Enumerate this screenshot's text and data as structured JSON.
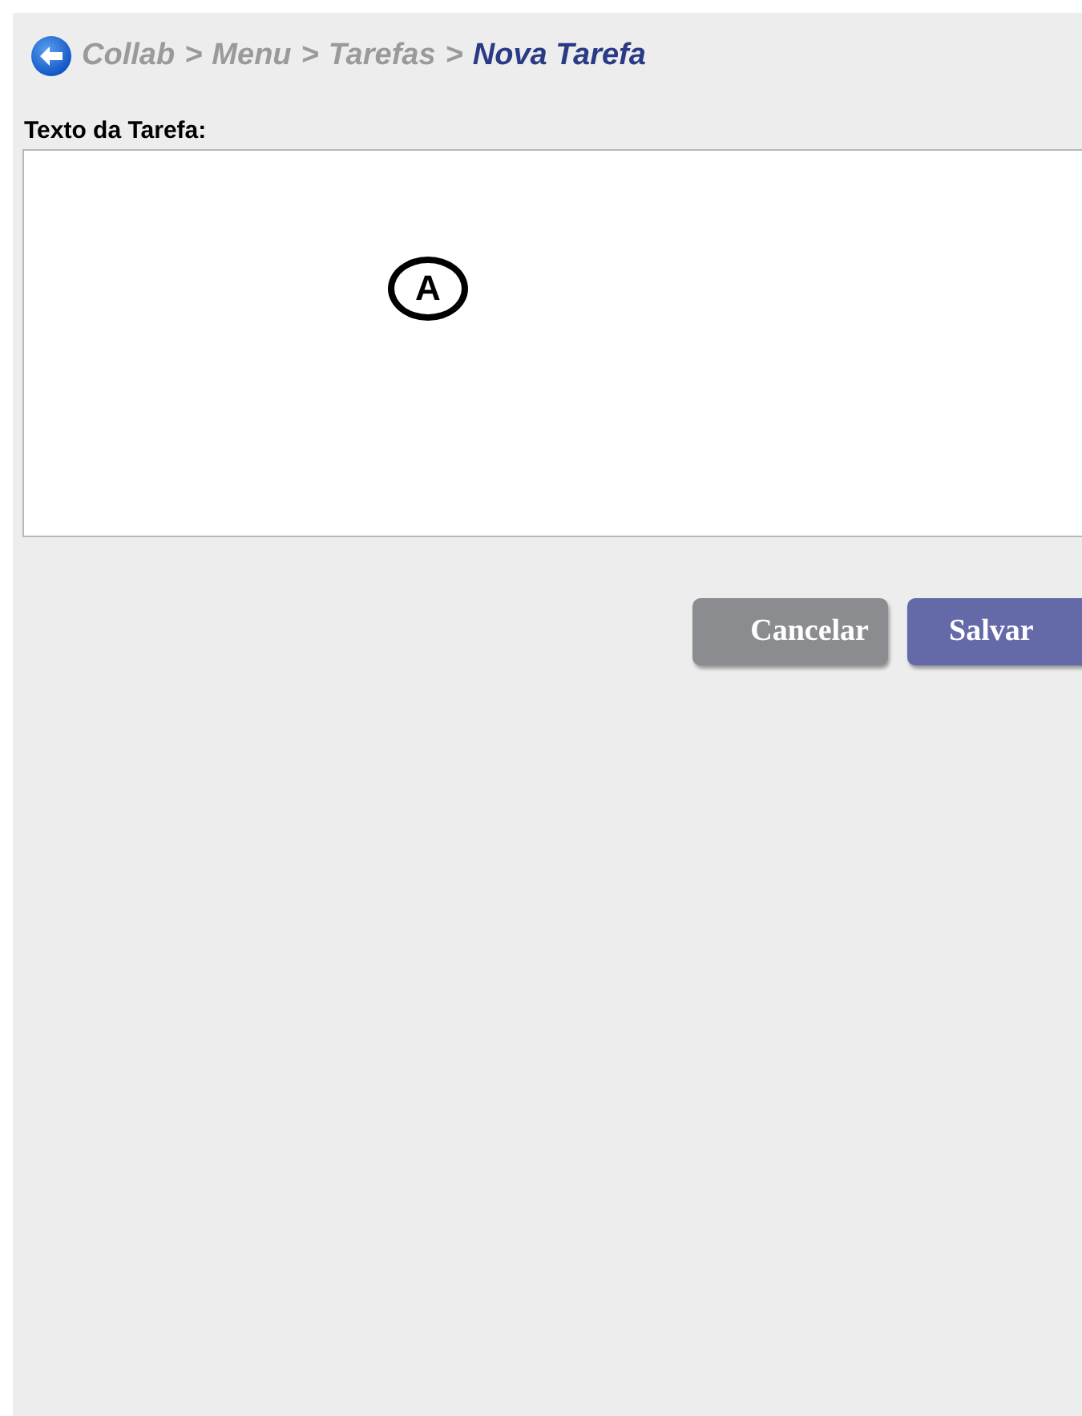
{
  "breadcrumb": [
    {
      "label": "Collab",
      "kind": "link"
    },
    {
      "label": "Menu",
      "kind": "link"
    },
    {
      "label": "Tarefas",
      "kind": "link"
    },
    {
      "label": "Nova Tarefa",
      "kind": "current"
    }
  ],
  "separator": ">",
  "field": {
    "label": "Texto da Tarefa:",
    "annotation": "A"
  },
  "buttons": [
    {
      "label": "Cancelar",
      "kind": "secondary"
    },
    {
      "label": "Salvar",
      "kind": "primary"
    }
  ]
}
